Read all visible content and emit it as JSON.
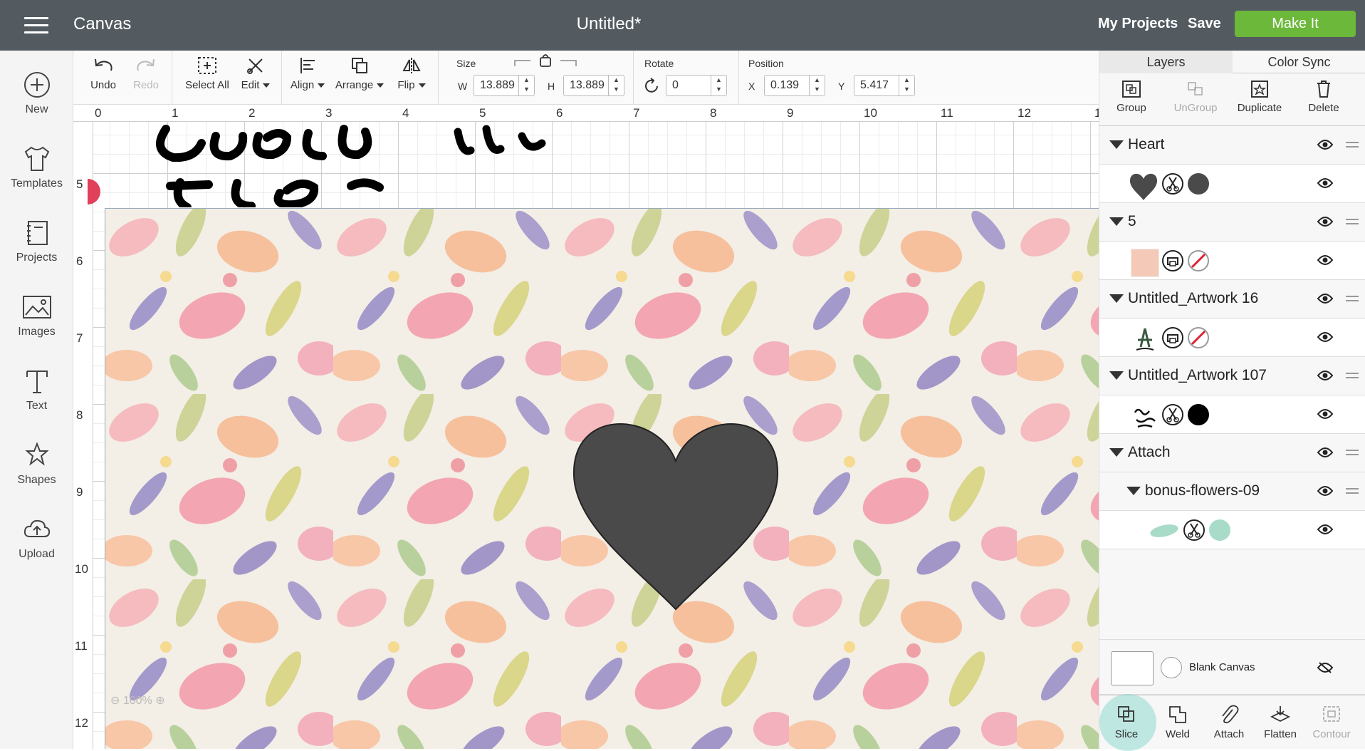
{
  "header": {
    "menu_icon": "hamburger-icon",
    "app_name": "Canvas",
    "doc_title": "Untitled*",
    "my_projects": "My Projects",
    "save": "Save",
    "make_it": "Make It",
    "make_it_color": "#6bb83a"
  },
  "sidebar": {
    "items": [
      {
        "label": "New",
        "icon": "plus-circle-icon"
      },
      {
        "label": "Templates",
        "icon": "tshirt-icon"
      },
      {
        "label": "Projects",
        "icon": "notebook-icon"
      },
      {
        "label": "Images",
        "icon": "image-icon"
      },
      {
        "label": "Text",
        "icon": "text-t-icon"
      },
      {
        "label": "Shapes",
        "icon": "shapes-icon"
      },
      {
        "label": "Upload",
        "icon": "cloud-upload-icon"
      }
    ]
  },
  "toolbar": {
    "undo": "Undo",
    "redo": "Redo",
    "select_all": "Select All",
    "edit": "Edit",
    "align": "Align",
    "arrange": "Arrange",
    "flip": "Flip",
    "size_label": "Size",
    "w_label": "W",
    "w_value": "13.889",
    "h_label": "H",
    "h_value": "13.889",
    "rotate_label": "Rotate",
    "rotate_value": "0",
    "position_label": "Position",
    "x_label": "X",
    "x_value": "0.139",
    "y_label": "Y",
    "y_value": "5.417"
  },
  "canvas": {
    "ruler_top": [
      "0",
      "1",
      "2",
      "3",
      "4",
      "5",
      "6",
      "7",
      "8",
      "9",
      "10",
      "11",
      "12",
      "1"
    ],
    "ruler_left": [
      "5",
      "6",
      "7",
      "8",
      "9",
      "10",
      "11",
      "12"
    ],
    "zoom": "100%"
  },
  "panel": {
    "tabs": [
      "Layers",
      "Color Sync"
    ],
    "actions": [
      "Group",
      "UnGroup",
      "Duplicate",
      "Delete"
    ],
    "layers": [
      {
        "name": "Heart"
      },
      {
        "name": "5"
      },
      {
        "name": "Untitled_Artwork 16"
      },
      {
        "name": "Untitled_Artwork 107"
      },
      {
        "name": "Attach"
      },
      {
        "name": "bonus-flowers-09"
      }
    ],
    "blank_canvas": "Blank Canvas",
    "bottom": [
      "Slice",
      "Weld",
      "Attach",
      "Flatten",
      "Contour"
    ],
    "colors": {
      "heart": "#4a4a4a",
      "artwork_black": "#000000",
      "flower_mint": "#a9dcc8"
    }
  }
}
